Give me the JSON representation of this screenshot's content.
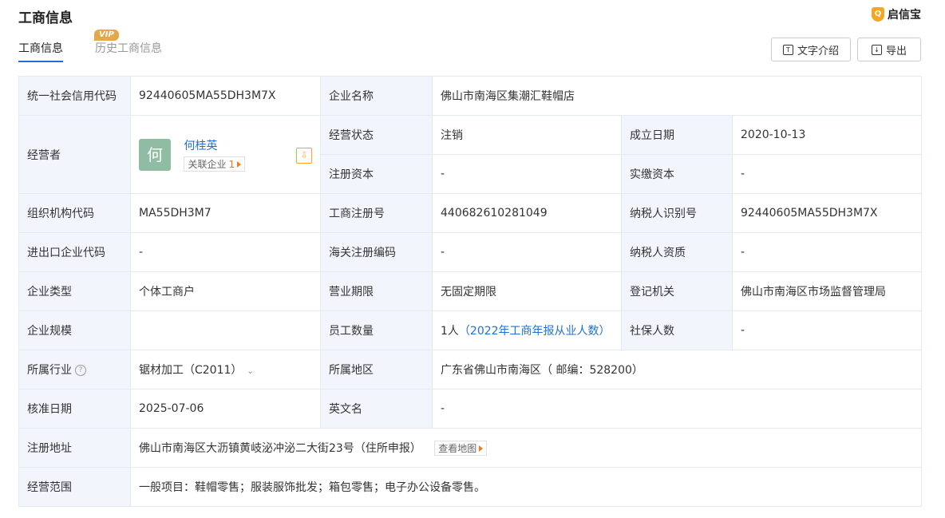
{
  "header": {
    "title": "工商信息",
    "logo": "启信宝"
  },
  "tabs": [
    {
      "label": "工商信息",
      "active": true
    },
    {
      "label": "历史工商信息",
      "badge": "VIP"
    }
  ],
  "actions": {
    "text_intro": "文字介绍",
    "export": "导出"
  },
  "info": {
    "credit_code_label": "统一社会信用代码",
    "credit_code": "92440605MA55DH3M7X",
    "name_label": "企业名称",
    "name": "佛山市南海区集潮汇鞋帽店",
    "operator_label": "经营者",
    "operator_avatar": "何",
    "operator_name": "何桂英",
    "related_label": "关联企业",
    "related_count": "1",
    "status_label": "经营状态",
    "status": "注销",
    "found_label": "成立日期",
    "found": "2020-10-13",
    "reg_cap_label": "注册资本",
    "reg_cap": "-",
    "paid_cap_label": "实缴资本",
    "paid_cap": "-",
    "org_code_label": "组织机构代码",
    "org_code": "MA55DH3M7",
    "reg_no_label": "工商注册号",
    "reg_no": "440682610281049",
    "tax_id_label": "纳税人识别号",
    "tax_id": "92440605MA55DH3M7X",
    "ie_code_label": "进出口企业代码",
    "ie_code": "-",
    "customs_label": "海关注册编码",
    "customs": "-",
    "tax_qual_label": "纳税人资质",
    "tax_qual": "-",
    "type_label": "企业类型",
    "type": "个体工商户",
    "term_label": "营业期限",
    "term": "无固定期限",
    "authority_label": "登记机关",
    "authority": "佛山市南海区市场监督管理局",
    "scale_label": "企业规模",
    "scale": "",
    "staff_label": "员工数量",
    "staff": "1人",
    "staff_note": "（2022年工商年报从业人数）",
    "insured_label": "社保人数",
    "insured": "-",
    "industry_label": "所属行业",
    "industry": "锯材加工（C2011）",
    "region_label": "所属地区",
    "region": "广东省佛山市南海区（ 邮编：528200）",
    "approve_label": "核准日期",
    "approve": "2025-07-06",
    "en_name_label": "英文名",
    "en_name": "-",
    "address_label": "注册地址",
    "address": "佛山市南海区大沥镇黄岐泌冲泌二大街23号（住所申报）",
    "map_link": "查看地图",
    "scope_label": "经营范围",
    "scope": "一般项目：鞋帽零售；服装服饰批发；箱包零售；电子办公设备零售。"
  }
}
